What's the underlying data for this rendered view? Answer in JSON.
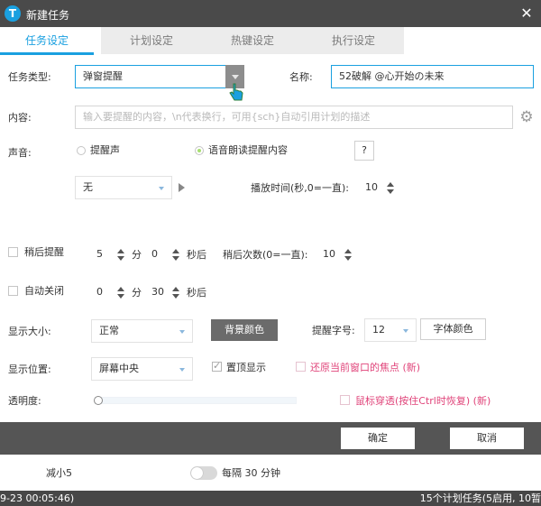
{
  "window": {
    "title": "新建任务",
    "close_glyph": "✕",
    "logo_letter": "T"
  },
  "tabs": [
    {
      "label": "任务设定",
      "active": true
    },
    {
      "label": "计划设定",
      "active": false
    },
    {
      "label": "热键设定",
      "active": false
    },
    {
      "label": "执行设定",
      "active": false
    }
  ],
  "form": {
    "task_type_label": "任务类型:",
    "task_type_value": "弹窗提醒",
    "name_label": "名称:",
    "name_value": "52破解 @心开始の未来",
    "content_label": "内容:",
    "content_placeholder": "输入要提醒的内容，\\n代表换行，可用{sch}自动引用计划的描述",
    "sound_label": "声音:",
    "sound_option_beep": "提醒声",
    "sound_option_tts": "语音朗读提醒内容",
    "sound_selected": "语音朗读提醒内容",
    "help_button": "?",
    "sound_file_value": "无",
    "play_time_label": "播放时间(秒,0=一直):",
    "play_time_value": "10",
    "snooze_label": "稍后提醒",
    "snooze_checked": false,
    "snooze_min_value": "5",
    "snooze_min_unit": "分",
    "snooze_sec_value": "0",
    "snooze_sec_unit": "秒后",
    "snooze_count_label": "稍后次数(0=一直):",
    "snooze_count_value": "10",
    "autoclose_label": "自动关闭",
    "autoclose_checked": false,
    "autoclose_min_value": "0",
    "autoclose_min_unit": "分",
    "autoclose_sec_value": "30",
    "autoclose_sec_unit": "秒后",
    "display_size_label": "显示大小:",
    "display_size_value": "正常",
    "bg_color_button": "背景颜色",
    "font_size_label": "提醒字号:",
    "font_size_value": "12",
    "font_color_button": "字体颜色",
    "position_label": "显示位置:",
    "position_value": "屏幕中央",
    "topmost_label": "置顶显示",
    "topmost_checked": true,
    "restore_focus_label": "还原当前窗口的焦点 (新)",
    "restore_focus_checked": false,
    "opacity_label": "透明度:",
    "opacity_value": 0,
    "click_through_label": "鼠标穿透(按住Ctrl时恢复) (新)",
    "click_through_checked": false
  },
  "footer": {
    "ok_button": "确定",
    "cancel_button": "取消"
  },
  "background": {
    "item_label": "减小5",
    "toggle_on": false,
    "interval_text": "每隔 30 分钟"
  },
  "statusbar": {
    "left_text": "9-23 00:05:46)",
    "right_text": "15个计划任务(5启用, 10暂"
  },
  "colors": {
    "accent": "#1aa0e0",
    "titlebar": "#4a4a4a",
    "footer_bar": "#555555",
    "highlight_pink": "#e0447a",
    "radio_checked": "#a7de6f"
  },
  "icons": {
    "logo": "app-logo-icon",
    "close": "close-icon",
    "settings": "gear-icon",
    "play": "play-icon",
    "pointer": "hand-pointer-icon"
  }
}
